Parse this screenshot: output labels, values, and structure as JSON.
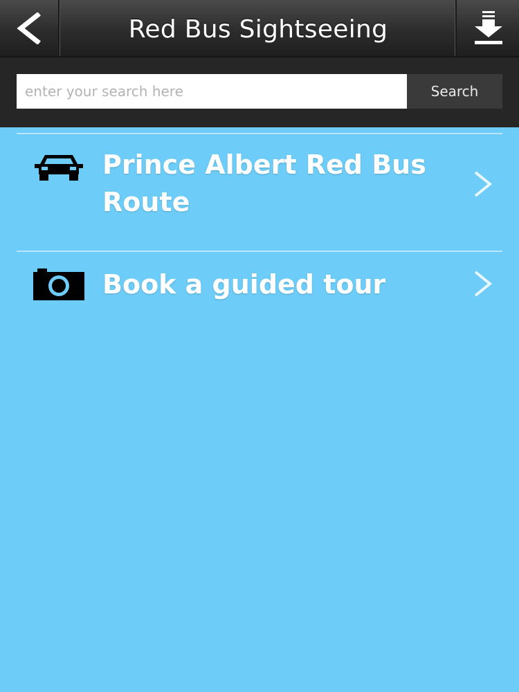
{
  "navbar": {
    "title": "Red Bus Sightseeing",
    "back_icon": "chevron-left-icon",
    "download_icon": "download-icon"
  },
  "search": {
    "placeholder": "enter your search here",
    "value": "",
    "button_label": "Search"
  },
  "list": {
    "items": [
      {
        "label": "Prince Albert Red Bus Route",
        "icon": "car-icon"
      },
      {
        "label": "Book a guided tour",
        "icon": "camera-icon"
      }
    ]
  },
  "colors": {
    "background": "#6ecdf8",
    "navbar": "#2c2c2c",
    "text": "#ffffff"
  }
}
